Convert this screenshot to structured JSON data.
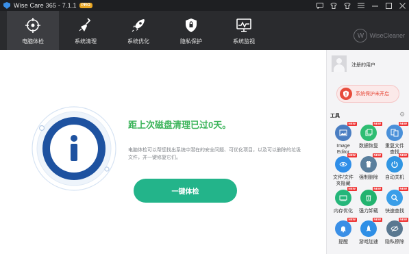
{
  "window": {
    "title": "Wise Care 365 - 7.1.1",
    "badge": "PRO",
    "controls": [
      "feedback-icon",
      "shirt-icon",
      "shirt-icon",
      "menu-icon",
      "minimize-icon",
      "maximize-icon",
      "close-icon"
    ]
  },
  "nav": {
    "tabs": [
      {
        "label": "电脑体检",
        "icon": "crosshair-icon",
        "active": true
      },
      {
        "label": "系统清理",
        "icon": "broom-icon",
        "active": false
      },
      {
        "label": "系统优化",
        "icon": "rocket-icon",
        "active": false
      },
      {
        "label": "隐私保护",
        "icon": "lock-shield-icon",
        "active": false
      },
      {
        "label": "系统监视",
        "icon": "monitor-icon",
        "active": false
      }
    ],
    "brand": "WiseCleaner"
  },
  "main": {
    "headline": "距上次磁盘清理已过0天。",
    "description": "电脑体检可以帮您找出系统中潜在的安全问题、可优化项目，以及可以删除的垃圾文件，并一键修复它们。",
    "button": "一键体检",
    "info_icon": "info-icon"
  },
  "sidebar": {
    "user_label": "注册的用户",
    "protection_label": "系统保护未开启",
    "tools_title": "工具",
    "tools": [
      {
        "label": "Image\nEditor",
        "icon": "image-icon",
        "color": "#4a7ec2",
        "new": "NEW"
      },
      {
        "label": "数据恢复",
        "icon": "restore-icon",
        "color": "#2ebd72",
        "new": "NEW"
      },
      {
        "label": "重复文件\n查找",
        "icon": "duplicate-icon",
        "color": "#4a90d9",
        "new": "NEW"
      },
      {
        "label": "文件/文件\n夹隐藏",
        "icon": "eye-icon",
        "color": "#2f8ee8",
        "new": "NEW"
      },
      {
        "label": "强制删除",
        "icon": "trash-icon",
        "color": "#5a7f9d",
        "new": "NEW"
      },
      {
        "label": "自动关机",
        "icon": "power-icon",
        "color": "#3196e3",
        "new": "NEW"
      },
      {
        "label": "内存优化",
        "icon": "memory-icon",
        "color": "#25b67a",
        "new": "NEW"
      },
      {
        "label": "强力卸载",
        "icon": "uninstall-icon",
        "color": "#22b36f",
        "new": "NEW"
      },
      {
        "label": "快速查找",
        "icon": "magnifier-icon",
        "color": "#3a9ee8",
        "new": "NEW"
      },
      {
        "label": "提醒",
        "icon": "bell-icon",
        "color": "#3a8fe6",
        "new": "NEW"
      },
      {
        "label": "游戏加速",
        "icon": "rocket-icon",
        "color": "#2f8fe6",
        "new": "NEW"
      },
      {
        "label": "隐私擦除",
        "icon": "eraser-icon",
        "color": "#5a7890",
        "new": "NEW"
      }
    ]
  },
  "colors": {
    "accent_green": "#23b48a",
    "headline_green": "#3cb45a",
    "info_blue": "#1e52a0",
    "alert_red": "#e74c3c"
  }
}
